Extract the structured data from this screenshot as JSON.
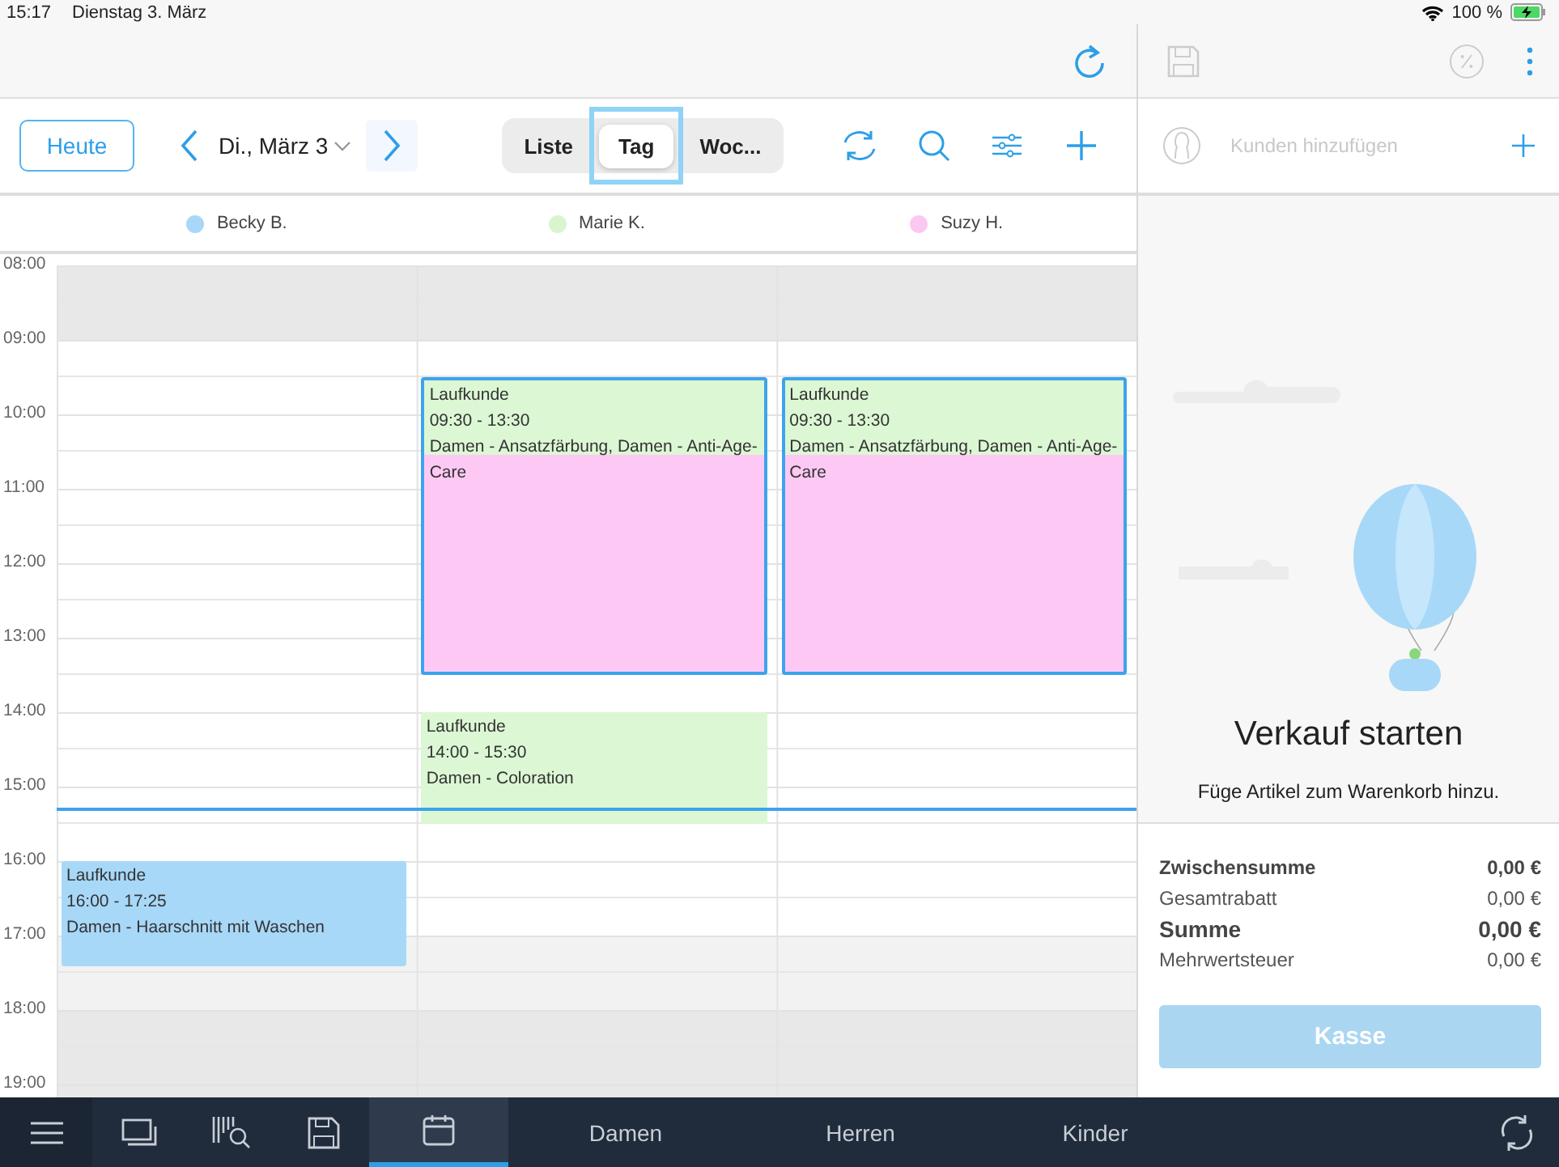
{
  "status_bar": {
    "time": "15:17",
    "date": "Dienstag 3. März",
    "battery": "100 %"
  },
  "toolbar": {
    "today_button": "Heute",
    "date": "Di., März 3",
    "views": [
      {
        "label": "Liste",
        "selected": false
      },
      {
        "label": "Tag",
        "selected": true
      },
      {
        "label": "Woc...",
        "selected": false
      }
    ]
  },
  "hours": [
    {
      "label": "08:00",
      "kind": "closed"
    },
    {
      "label": "09:00",
      "kind": "open"
    },
    {
      "label": "10:00",
      "kind": "open"
    },
    {
      "label": "11:00",
      "kind": "open"
    },
    {
      "label": "12:00",
      "kind": "open"
    },
    {
      "label": "13:00",
      "kind": "open"
    },
    {
      "label": "14:00",
      "kind": "open"
    },
    {
      "label": "15:00",
      "kind": "open"
    },
    {
      "label": "16:00",
      "kind": "open"
    },
    {
      "label": "17:00",
      "kind": "evening"
    },
    {
      "label": "18:00",
      "kind": "closed"
    },
    {
      "label": "19:00",
      "kind": "closed"
    }
  ],
  "staff": [
    {
      "name": "Becky B.",
      "color": "#a8d8f8",
      "appointments": [
        {
          "customer": "Laufkunde",
          "time": "16:00 - 17:25",
          "service": "Damen - Haarschnitt mit Waschen",
          "selected": false,
          "segments": [
            {
              "color": "#a8d8f8"
            }
          ]
        }
      ]
    },
    {
      "name": "Marie K.",
      "color": "#d8f5d0",
      "appointments": [
        {
          "customer": "Laufkunde",
          "time": "09:30 - 13:30",
          "service": "Damen - Ansatzfärbung, Damen - Anti-Age-Care",
          "selected": true,
          "segments": [
            {
              "color": "#dcf7d4"
            },
            {
              "color": "#fdc9f4"
            }
          ]
        },
        {
          "customer": "Laufkunde",
          "time": "14:00 - 15:30",
          "service": "Damen - Coloration",
          "selected": false,
          "segments": [
            {
              "color": "#dcf7d4"
            }
          ]
        }
      ]
    },
    {
      "name": "Suzy H.",
      "color": "#fcc8f2",
      "appointments": [
        {
          "customer": "Laufkunde",
          "time": "09:30 - 13:30",
          "service": "Damen - Ansatzfärbung, Damen - Anti-Age-Care",
          "selected": true,
          "segments": [
            {
              "color": "#dcf7d4"
            },
            {
              "color": "#fdc9f4"
            }
          ]
        }
      ]
    }
  ],
  "cart": {
    "customer_placeholder": "Kunden hinzufügen",
    "empty_title": "Verkauf starten",
    "empty_text": "Füge Artikel zum Warenkorb hinzu.",
    "totals": [
      {
        "label": "Zwischensumme",
        "value": "0,00 €",
        "kind": "subtotal"
      },
      {
        "label": "Gesamtrabatt",
        "value": "0,00 €",
        "kind": "normal"
      },
      {
        "label": "Summe",
        "value": "0,00 €",
        "kind": "total"
      },
      {
        "label": "Mehrwertsteuer",
        "value": "0,00 €",
        "kind": "normal"
      }
    ],
    "checkout_button": {
      "label": "Kasse",
      "disabled": true
    }
  },
  "bottom_nav": {
    "icons": [
      {
        "selected": false
      },
      {
        "selected": false
      },
      {
        "selected": false
      },
      {
        "selected": false
      },
      {
        "selected": true
      }
    ],
    "categories": [
      {
        "label": "Damen",
        "selected": false
      },
      {
        "label": "Herren",
        "selected": false
      },
      {
        "label": "Kinder",
        "selected": false
      }
    ]
  }
}
